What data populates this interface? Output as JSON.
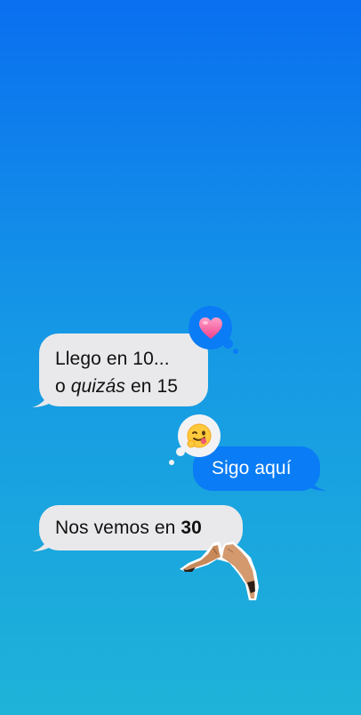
{
  "messages": [
    {
      "id": "m1",
      "direction": "incoming",
      "line1": "Llego en 10...",
      "line2_prefix": "o ",
      "line2_emphasis": "quizás",
      "line2_suffix": " en 15",
      "reaction": "heart-icon"
    },
    {
      "id": "m2",
      "direction": "outgoing",
      "text": "Sigo aquí",
      "reaction": "winking-tongue-face-icon"
    },
    {
      "id": "m3",
      "direction": "incoming",
      "text_prefix": "Nos vemos en ",
      "text_bold": "30",
      "sticker": "heart-hands-sticker"
    }
  ],
  "colors": {
    "background_top": "#0a6ff0",
    "background_bottom": "#1fb3d8",
    "incoming_bubble": "#e9e9eb",
    "outgoing_bubble": "#0a7cf5"
  }
}
